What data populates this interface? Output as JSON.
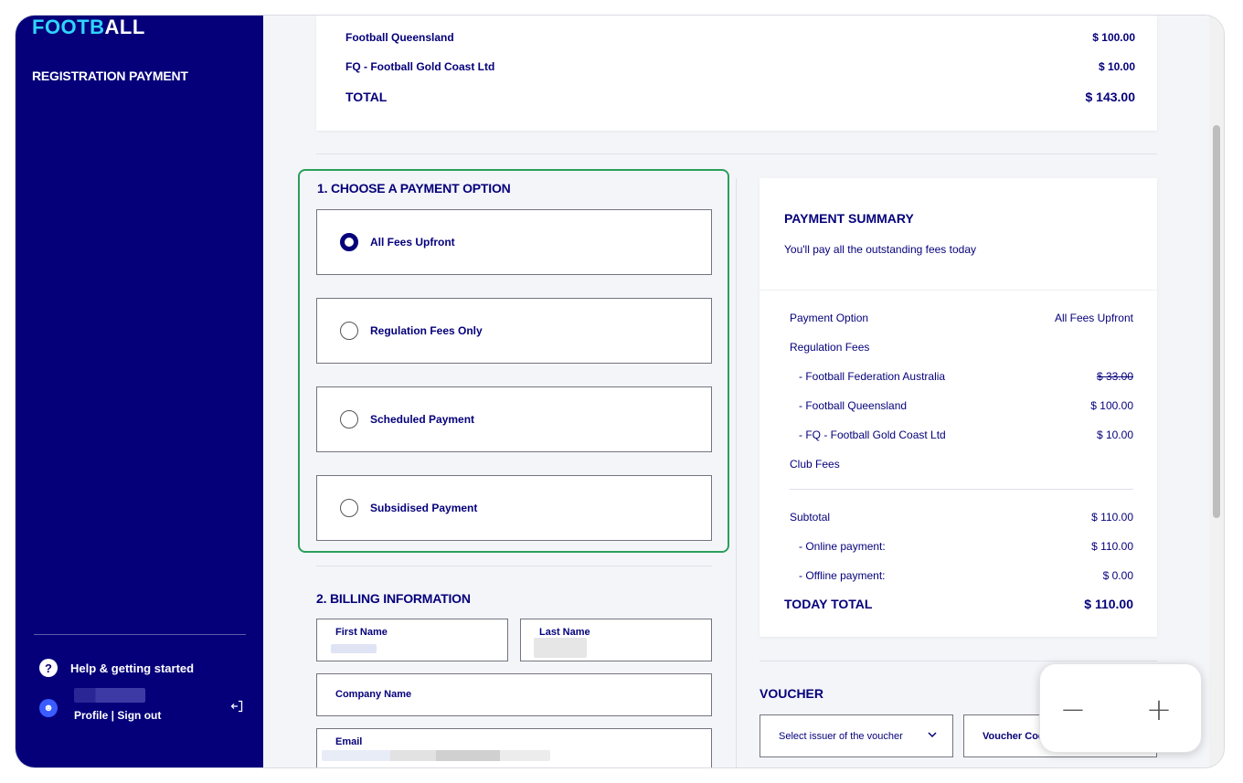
{
  "sidebar": {
    "logo_part1": "FOOTB",
    "logo_part2": "ALL",
    "title": "REGISTRATION PAYMENT",
    "help_label": "Help & getting started",
    "profile_links": "Profile | Sign out",
    "avatar_glyph": "☻",
    "help_glyph": "?"
  },
  "fees": {
    "rows": [
      {
        "name": "Football Queensland",
        "amount": "$ 100.00"
      },
      {
        "name": "FQ - Football Gold Coast Ltd",
        "amount": "$ 10.00"
      }
    ],
    "total_label": "TOTAL",
    "total_amount": "$ 143.00"
  },
  "payment_option": {
    "title": "1. CHOOSE A PAYMENT OPTION",
    "options": [
      {
        "label": "All Fees Upfront",
        "selected": true
      },
      {
        "label": "Regulation Fees Only",
        "selected": false
      },
      {
        "label": "Scheduled Payment",
        "selected": false
      },
      {
        "label": "Subsidised Payment",
        "selected": false
      }
    ]
  },
  "billing": {
    "title": "2. BILLING INFORMATION",
    "first_name_label": "First Name",
    "last_name_label": "Last Name",
    "company_label": "Company Name",
    "email_label": "Email"
  },
  "summary": {
    "title": "PAYMENT SUMMARY",
    "subtitle": "You'll pay all the outstanding fees today",
    "payment_option_label": "Payment Option",
    "payment_option_value": "All Fees Upfront",
    "regulation_fees_label": "Regulation Fees",
    "ffa_label": "- Football Federation Australia",
    "ffa_value": "$ 33.00",
    "fq_label": "- Football Queensland",
    "fq_value": "$ 100.00",
    "fqgc_label": "- FQ - Football Gold Coast Ltd",
    "fqgc_value": "$ 10.00",
    "club_fees_label": "Club Fees",
    "subtotal_label": "Subtotal",
    "subtotal_value": "$ 110.00",
    "online_label": "- Online payment:",
    "online_value": "$ 110.00",
    "offline_label": "- Offline payment:",
    "offline_value": "$ 0.00",
    "today_total_label": "TODAY TOTAL",
    "today_total_value": "$ 110.00"
  },
  "voucher": {
    "title": "VOUCHER",
    "issuer_placeholder": "Select issuer of the voucher",
    "code_label": "Voucher Code"
  },
  "zoom": {
    "minus": "−",
    "plus": "+"
  },
  "colors": {
    "navy": "#05007a",
    "cyan": "#2fd5ff",
    "highlight_green": "#2aa05a"
  }
}
